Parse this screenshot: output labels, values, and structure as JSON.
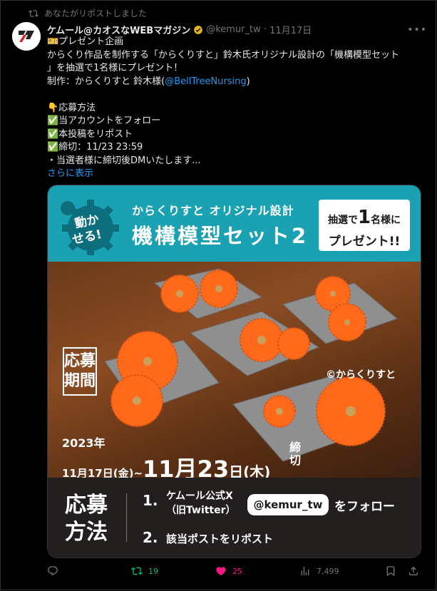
{
  "repost_notice": "あなたがリポストしました",
  "author": {
    "name": "ケムール@カオスなWEBマガジン",
    "handle": "@kemur_tw",
    "date": "11月17日"
  },
  "tweet": {
    "lines": [
      "🎫プレゼント企画",
      "からくり作品を制作する「からくりすと」鈴木氏オリジナル設計の「機構模型セット",
      "」を抽選で1名様にプレゼント！",
      "制作：からくりすと 鈴木様("
    ],
    "mention": "@BellTreeNursing",
    "mention_close": ")",
    "blank": "",
    "apply_header": "👇応募方法",
    "checks": [
      "✅当アカウントをフォロー",
      "✅本投稿をリポスト",
      "✅締切：11/23 23:59"
    ],
    "note": "・当選者様に締切後DMいたします...",
    "show_more": "さらに表示"
  },
  "image": {
    "gear_text": "動かせる!",
    "subtitle": "からくりすと オリジナル設計",
    "title": "機構模型セット2",
    "prize_line1_a": "抽選で",
    "prize_line1_b": "1",
    "prize_line1_c": "名様に",
    "prize_line2": "プレゼント!!",
    "period_label": "応募期間",
    "copyright": "©からくりすと",
    "year": "2023年",
    "date_start": "11月17日(金)~",
    "date_end_big": "11月23",
    "date_end_day": "日(木)",
    "deadline": "締切",
    "method_label": "応募方法",
    "step1_num": "1.",
    "step1_line1": "ケムール公式X",
    "step1_line2": "（旧Twitter）",
    "step1_handle": "@kemur_tw",
    "step1_follow": "をフォロー",
    "step2_num": "2.",
    "step2_text": "該当ポストをリポスト"
  },
  "stats": {
    "reposts": "19",
    "likes": "25",
    "views": "7,499"
  },
  "colors": {
    "accent": "#1d9bf0",
    "repost": "#00ba7c",
    "like": "#f91880",
    "banner": "#1aa2b3",
    "gear": "#ff6a1a"
  }
}
